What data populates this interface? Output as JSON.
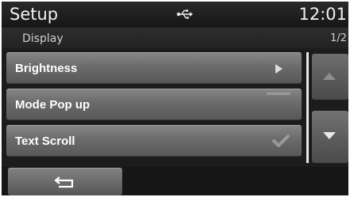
{
  "header": {
    "title": "Setup",
    "status_icon": "usb-icon",
    "clock": "12:01"
  },
  "subheader": {
    "section": "Display",
    "page": "1/2"
  },
  "menu": {
    "items": [
      {
        "label": "Brightness",
        "indicator": "arrow-right-icon"
      },
      {
        "label": "Mode Pop up",
        "indicator": "dash-icon"
      },
      {
        "label": "Text Scroll",
        "indicator": "check-icon"
      }
    ]
  },
  "scroll": {
    "up_icon": "up-arrow-icon",
    "up_enabled": false,
    "down_icon": "down-arrow-icon",
    "down_enabled": true
  },
  "footer": {
    "back_icon": "back-icon"
  },
  "colors": {
    "background": "#1c1c1c",
    "button": "#6b6b6b",
    "text": "#ffffff",
    "disabled_arrow": "#8e8e8e"
  }
}
